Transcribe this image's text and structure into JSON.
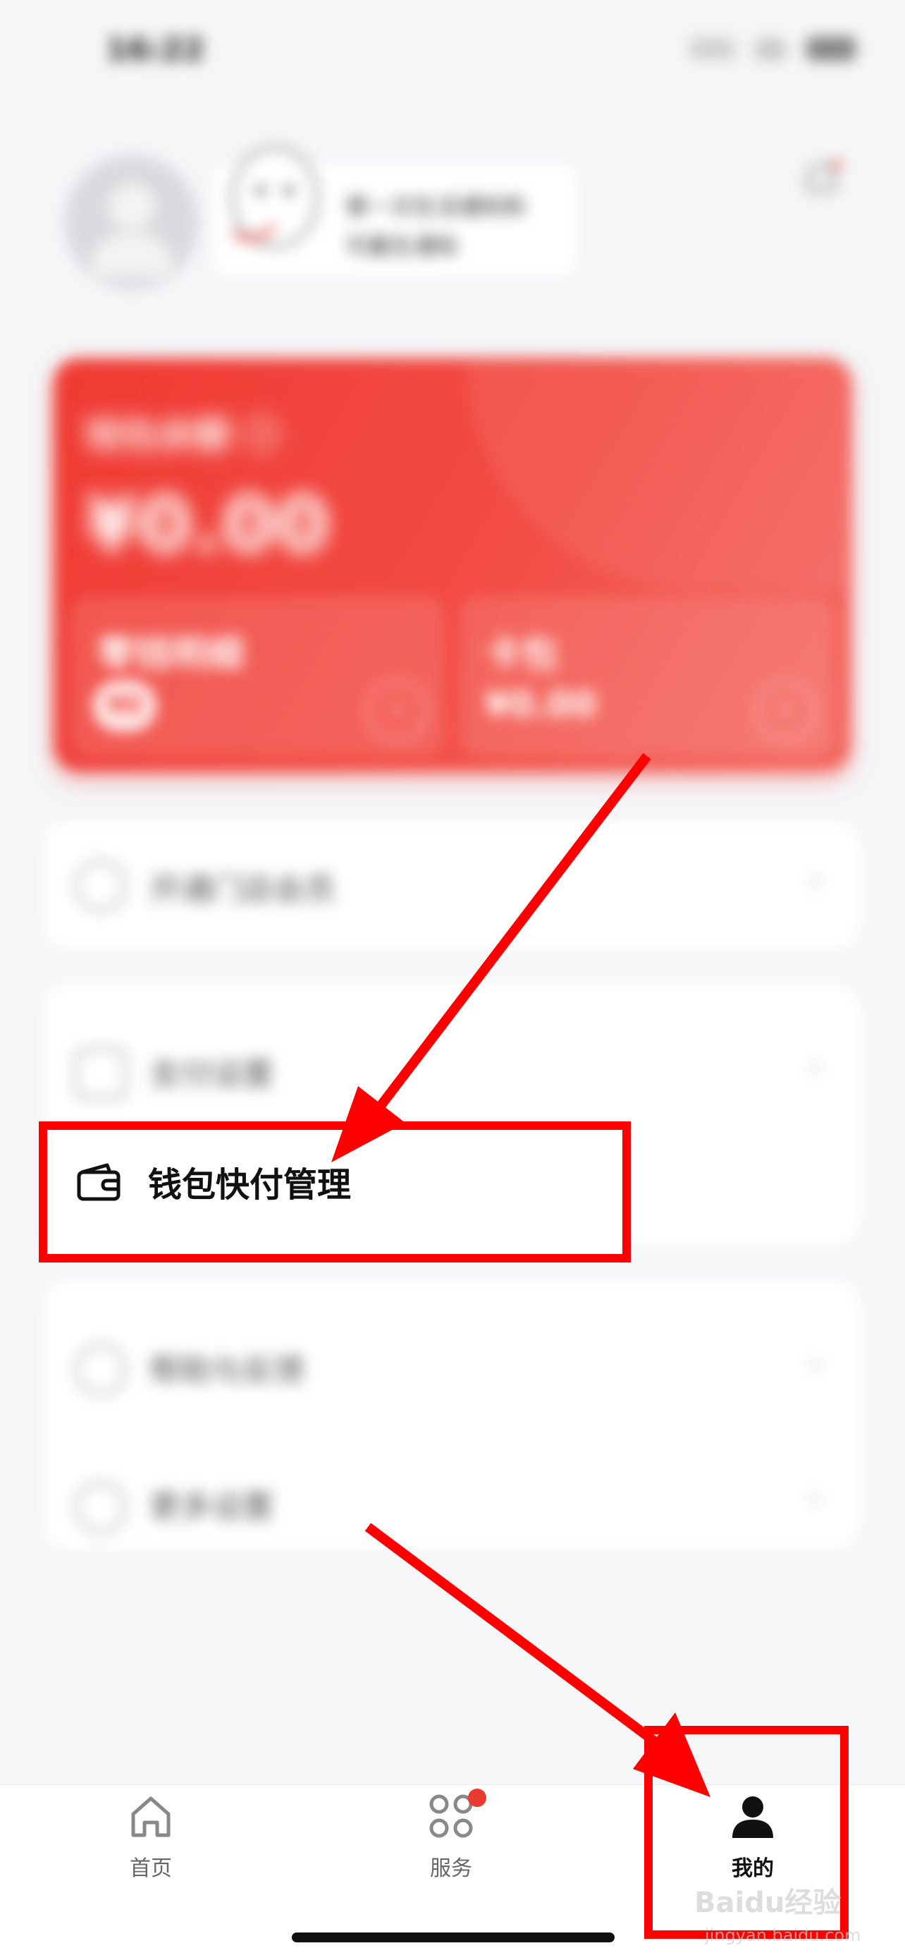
{
  "status_bar": {
    "time": "16:22"
  },
  "profile": {
    "bubble_text": "第一次生活通知和\n可最生通知"
  },
  "card": {
    "title": "钱包余额 ⓘ",
    "amount": "¥0.00",
    "left": {
      "title": "零钱明细",
      "pill": "¥0",
      "arrow": "›"
    },
    "right": {
      "title": "卡包",
      "value": "¥0.00",
      "arrow": "›"
    }
  },
  "menu": {
    "group1": [
      {
        "icon": "circle-icon",
        "label": "开通门店会员"
      }
    ],
    "group2": [
      {
        "icon": "pay-settings-icon",
        "label": "支付设置"
      }
    ],
    "group3": [
      {
        "icon": "help-icon",
        "label": "帮助与反馈"
      },
      {
        "icon": "settings-icon",
        "label": "更多设置"
      }
    ],
    "chevron": "›"
  },
  "highlight": {
    "label": "钱包快付管理",
    "icon": "wallet-icon"
  },
  "tabbar": {
    "tabs": [
      {
        "label": "首页",
        "icon": "home-icon"
      },
      {
        "label": "服务",
        "icon": "services-icon"
      },
      {
        "label": "我的",
        "icon": "profile-icon",
        "active": true
      }
    ]
  },
  "watermark": {
    "brand": "Baidu经验",
    "site": "jingyan.baidu.com"
  },
  "colors": {
    "accent": "#ef3a33",
    "annotation": "#ff0000"
  }
}
